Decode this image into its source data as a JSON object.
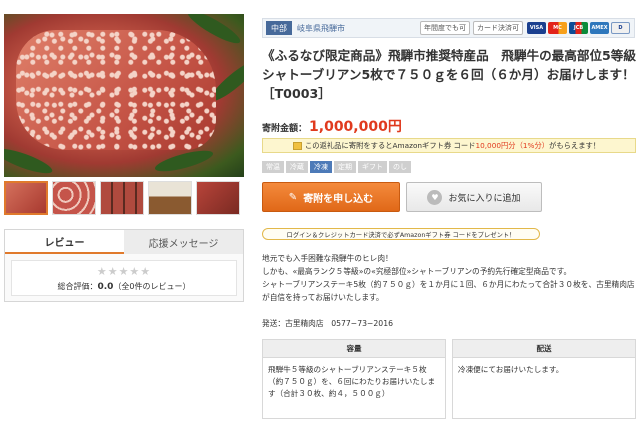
{
  "gallery": {
    "main_image": "steak-photo",
    "thumbnails": [
      "steak-block",
      "steak-slices",
      "steak-packs",
      "shop-front",
      "steak-cut"
    ]
  },
  "review_panel": {
    "tabs": [
      {
        "label": "レビュー"
      },
      {
        "label": "応援メッセージ"
      }
    ],
    "stars": "★★★★★",
    "score_prefix": "総合評価：",
    "score_value": "0.0",
    "score_count": "（全0件のレビュー）"
  },
  "header_bar": {
    "region": "中部",
    "city": "岐阜県飛騨市",
    "badges": [
      "年間度でも可",
      "カード決済可"
    ],
    "cards": [
      "VISA",
      "MC",
      "JCB",
      "AMEX",
      "D"
    ]
  },
  "product": {
    "title": "《ふるなび限定商品》飛騨市推奨特産品　飛騨牛の最高部位5等級シャトーブリアン5枚で７５０ｇを６回（６か月）お届けします！［T0003］",
    "price_label": "寄附金額：",
    "price": "1,000,000円"
  },
  "amazon_notice": {
    "before": "この返礼品に寄附をするとAmazonギフト券 コード",
    "highlight": "10,000円分（1%分）",
    "after": "がもらえます！"
  },
  "categories": [
    {
      "label": "常温",
      "active": false
    },
    {
      "label": "冷蔵",
      "active": false
    },
    {
      "label": "冷凍",
      "active": true
    },
    {
      "label": "定期",
      "active": false
    },
    {
      "label": "ギフト",
      "active": false
    },
    {
      "label": "のし",
      "active": false
    }
  ],
  "actions": {
    "apply": "寄附を申し込む",
    "favorite": "お気に入りに追加"
  },
  "login_notice": "ログイン＆クレジットカード決済で必ずAmazonギフト券 コードをプレゼント！",
  "description": [
    "地元でも入手困難な飛騨牛のヒレ肉！",
    "しかも、«最高ランク５等級»の«究極部位»シャトーブリアンの予約先行確定型商品です。",
    "シャトーブリアンステーキ5枚（約７５０ｇ）を１か月に１回、６か月にわたって合計３０枚を、古里精肉店が自信を持ってお届けいたします。"
  ],
  "shipper": "発送：古里精肉店　0577−73−2016",
  "spec": {
    "capacity_header": "容量",
    "capacity_text": "飛騨牛５等級のシャトーブリアンステーキ５枚（約７５０ｇ）を、６回にわたりお届けいたします（合計３０枚、約４，５００ｇ）",
    "delivery_header": "配送",
    "delivery_text": "冷凍便にてお届けいたします。"
  }
}
